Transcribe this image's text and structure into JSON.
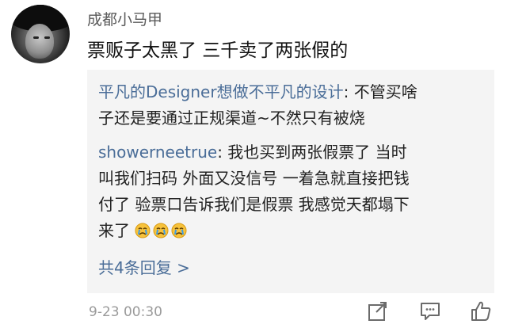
{
  "comment": {
    "username": "成都小马甲",
    "content": "票贩子太黑了 三千卖了两张假的",
    "timestamp": "9-23 00:30"
  },
  "replies": [
    {
      "author": "平凡的Designer想做不平凡的设计",
      "text_line1": ": 不管买啥",
      "text_line2": "子还是要通过正规渠道~不然只有被烧"
    },
    {
      "author": "showerneetrue",
      "text_line1": ": 我也买到两张假票了 当时",
      "text_line2": "叫我们扫码 外面又没信号 一着急就直接把钱",
      "text_line3": "付了 验票口告诉我们是假票 我感觉天都塌下",
      "text_line4": "来了",
      "emoji": [
        "crying-face",
        "crying-face",
        "crying-face"
      ]
    }
  ],
  "more_replies_label": "共4条回复 >",
  "actions": [
    "share-icon",
    "comment-icon",
    "like-icon"
  ]
}
